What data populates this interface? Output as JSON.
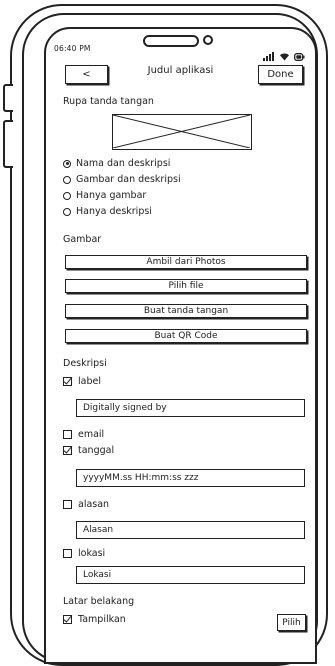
{
  "status_bar": {
    "time": "06:40 PM",
    "icons": [
      "signal-icon",
      "wifi-icon",
      "battery-icon"
    ]
  },
  "header": {
    "back_label": "<",
    "title": "Judul aplikasi",
    "done_label": "Done"
  },
  "signature": {
    "label": "Rupa tanda tangan",
    "options": [
      {
        "label": "Nama dan deskripsi",
        "selected": true
      },
      {
        "label": "Gambar dan deskripsi",
        "selected": false
      },
      {
        "label": "Hanya gambar",
        "selected": false
      },
      {
        "label": "Hanya deskripsi",
        "selected": false
      }
    ]
  },
  "image": {
    "label": "Gambar",
    "buttons": [
      "Ambil dari Photos",
      "Pilih file",
      "Buat tanda tangan",
      "Buat QR Code"
    ]
  },
  "description": {
    "label": "Deskripsi",
    "fields": [
      {
        "label": "label",
        "checked": true,
        "value": "Digitally signed by"
      },
      {
        "label": "email",
        "checked": false
      },
      {
        "label": "tanggal",
        "checked": true,
        "value": "yyyyMM.ss HH:mm:ss zzz"
      },
      {
        "label": "alasan",
        "checked": false,
        "placeholder": "Alasan"
      },
      {
        "label": "lokasi",
        "checked": false,
        "placeholder": "Lokasi"
      }
    ]
  },
  "background": {
    "label": "Latar belakang",
    "show_label": "Tampilkan",
    "show_checked": true,
    "pick_label": "Pilih"
  }
}
